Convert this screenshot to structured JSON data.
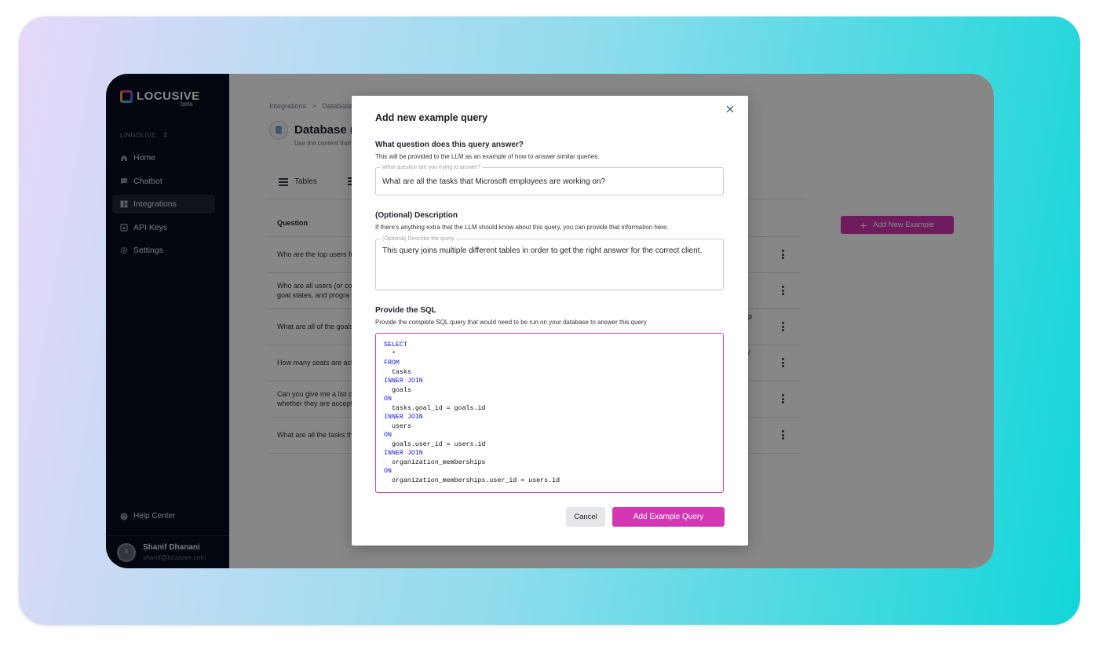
{
  "brand": {
    "name": "LOCUSIVE",
    "tag": "beta"
  },
  "sidebar": {
    "workspace": "LINGOLIVE",
    "items": [
      {
        "label": "Home",
        "icon": "home-icon"
      },
      {
        "label": "Chatbot",
        "icon": "chat-icon"
      },
      {
        "label": "Integrations",
        "icon": "grid-icon",
        "active": true
      },
      {
        "label": "API Keys",
        "icon": "key-icon"
      },
      {
        "label": "Settings",
        "icon": "gear-icon"
      }
    ],
    "help": "Help Center",
    "user": {
      "initial": "S",
      "name": "Shanif Dhanani",
      "email": "shanif@locusive.com"
    }
  },
  "main": {
    "breadcrumb": {
      "first": "Integrations",
      "sep": ">",
      "second": "Database"
    },
    "title": "Database (L",
    "subtitle": "Use the content from",
    "tabs": [
      {
        "label": "Tables"
      },
      {
        "label": ""
      }
    ],
    "table_header": "Question",
    "rows": [
      {
        "text": "Who are the top users fr",
        "extra": ""
      },
      {
        "text": "Who are all users (or co goal states, and progra",
        "extra": ""
      },
      {
        "text": "What are all of the goals",
        "extra": "p"
      },
      {
        "text": "How many seats are act",
        "extra": "/"
      },
      {
        "text": "Can you give me a list o whether they are accept",
        "extra": ""
      },
      {
        "text": "What are all the tasks th",
        "extra": ""
      }
    ],
    "add_button": "Add New Example"
  },
  "modal": {
    "title": "Add new example query",
    "question_section": {
      "title": "What question does this query answer?",
      "help": "This will be provided to the LLM as an example of how to answer similar queries.",
      "legend": "What question are you trying to answer?",
      "value": "What are all the tasks that Microsoft employees are working on?"
    },
    "description_section": {
      "title": "(Optional) Description",
      "help": "If there's anything extra that the LLM should know about this query, you can provide that information here.",
      "legend": "(Optional) Describe the query",
      "value": "This query joins multiple different tables in order to get the right answer for the correct client."
    },
    "sql_section": {
      "title": "Provide the SQL",
      "help": "Provide the complete SQL query that would need to be run on your database to answer this query",
      "lines": [
        {
          "text": "SELECT",
          "kw": true
        },
        {
          "text": "  *",
          "kw": false
        },
        {
          "text": "FROM",
          "kw": true
        },
        {
          "text": "  tasks",
          "kw": false
        },
        {
          "text": "INNER JOIN",
          "kw": true
        },
        {
          "text": "  goals",
          "kw": false
        },
        {
          "text": "ON",
          "kw": true
        },
        {
          "text": "  tasks.goal_id = goals.id",
          "kw": false
        },
        {
          "text": "INNER JOIN",
          "kw": true
        },
        {
          "text": "  users",
          "kw": false
        },
        {
          "text": "ON",
          "kw": true
        },
        {
          "text": "  goals.user_id = users.id",
          "kw": false
        },
        {
          "text": "INNER JOIN",
          "kw": true
        },
        {
          "text": "  organization_memberships",
          "kw": false
        },
        {
          "text": "ON",
          "kw": true
        },
        {
          "text": "  organization_memberships.user_id = users.id",
          "kw": false
        }
      ]
    },
    "cancel_label": "Cancel",
    "submit_label": "Add Example Query"
  },
  "colors": {
    "accent": "#d337b4",
    "sidebar_bg": "#050c1e",
    "sql_keyword": "#0f14d8"
  }
}
